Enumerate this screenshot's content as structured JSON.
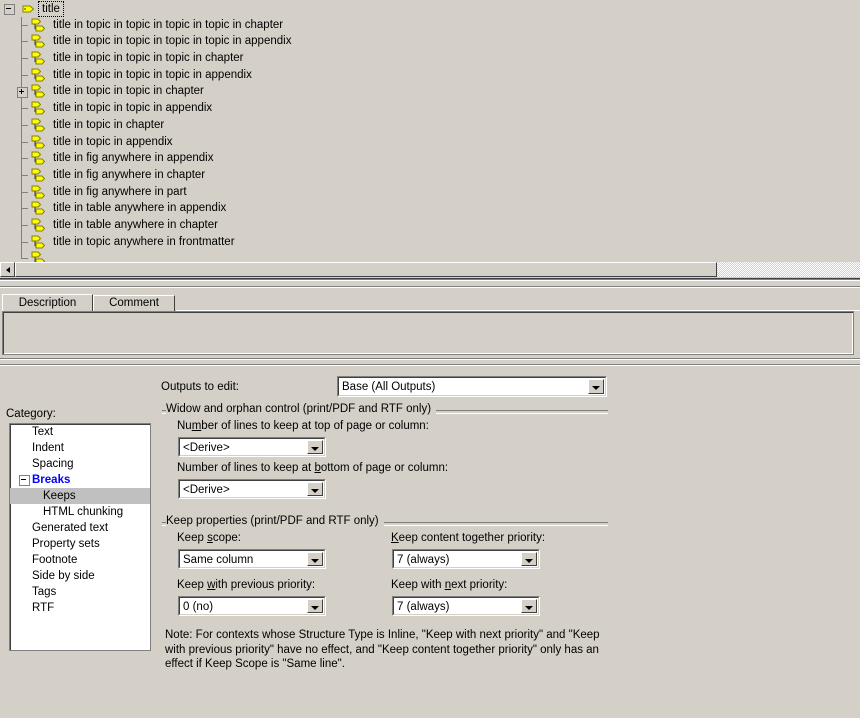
{
  "tree": {
    "root": {
      "label": "title",
      "icon": "tag-icon",
      "expander": "minus"
    },
    "items": [
      {
        "label": "title in topic in topic in topic in topic in chapter",
        "icon": "context-tag-icon",
        "expander": null
      },
      {
        "label": "title in topic in topic in topic in topic in appendix",
        "icon": "context-tag-icon",
        "expander": null
      },
      {
        "label": "title in topic in topic in topic in chapter",
        "icon": "context-tag-icon",
        "expander": null
      },
      {
        "label": "title in topic in topic in topic in appendix",
        "icon": "context-tag-icon",
        "expander": null
      },
      {
        "label": "title in topic in topic in chapter",
        "icon": "context-tag-icon",
        "expander": "plus"
      },
      {
        "label": "title in topic in topic in appendix",
        "icon": "context-tag-icon",
        "expander": null
      },
      {
        "label": "title in topic in chapter",
        "icon": "context-tag-icon",
        "expander": null
      },
      {
        "label": "title in topic in appendix",
        "icon": "context-tag-icon",
        "expander": null
      },
      {
        "label": "title in fig anywhere in appendix",
        "icon": "context-tag-icon",
        "expander": null
      },
      {
        "label": "title in fig anywhere in chapter",
        "icon": "context-tag-icon",
        "expander": null
      },
      {
        "label": "title in fig anywhere in part",
        "icon": "context-tag-icon",
        "expander": null
      },
      {
        "label": "title in table anywhere in appendix",
        "icon": "context-tag-icon",
        "expander": null
      },
      {
        "label": "title in table anywhere in chapter",
        "icon": "context-tag-icon",
        "expander": null
      },
      {
        "label": "title in topic anywhere in frontmatter",
        "icon": "context-tag-icon",
        "expander": null
      }
    ]
  },
  "scrollbar": {
    "left_arrow_icon": "triangle-left-icon"
  },
  "tabs": {
    "items": [
      {
        "label": "Description",
        "selected": true
      },
      {
        "label": "Comment",
        "selected": false
      }
    ]
  },
  "description": {
    "value": ""
  },
  "outputs": {
    "label": "Outputs to edit:",
    "value": "Base (All Outputs)",
    "dropdown_icon": "chevron-down-icon"
  },
  "category": {
    "label": "Category:",
    "items": [
      {
        "label": "Text",
        "type": "item",
        "selected": false
      },
      {
        "label": "Indent",
        "type": "item",
        "selected": false
      },
      {
        "label": "Spacing",
        "type": "item",
        "selected": false
      },
      {
        "label": "Breaks",
        "type": "group",
        "selected": false
      },
      {
        "label": "Keeps",
        "type": "child",
        "selected": true
      },
      {
        "label": "HTML chunking",
        "type": "child",
        "selected": false
      },
      {
        "label": "Generated text",
        "type": "item",
        "selected": false
      },
      {
        "label": "Property sets",
        "type": "item",
        "selected": false
      },
      {
        "label": "Footnote",
        "type": "item",
        "selected": false
      },
      {
        "label": "Side by side",
        "type": "item",
        "selected": false
      },
      {
        "label": "Tags",
        "type": "item",
        "selected": false
      },
      {
        "label": "RTF",
        "type": "item",
        "selected": false
      }
    ]
  },
  "widow_group": {
    "title": "Widow and orphan control (print/PDF and RTF only)",
    "top_label_pre": "Nu",
    "top_label_accel": "m",
    "top_label_post": "ber of lines to keep at top of page or column:",
    "top_value": "<Derive>",
    "bottom_label_pre": "Number of lines to keep at ",
    "bottom_label_accel": "b",
    "bottom_label_post": "ottom of page or column:",
    "bottom_value": "<Derive>"
  },
  "keep_group": {
    "title": "Keep properties (print/PDF and RTF only)",
    "scope_label_pre": "Keep ",
    "scope_label_accel": "s",
    "scope_label_post": "cope:",
    "scope_value": "Same column",
    "together_label_pre": "",
    "together_label_accel": "K",
    "together_label_post": "eep content together priority:",
    "together_value": "7 (always)",
    "previous_label_pre": "Keep ",
    "previous_label_accel": "w",
    "previous_label_post": "ith previous priority:",
    "previous_value": "0 (no)",
    "next_label_pre": "Keep with ",
    "next_label_accel": "n",
    "next_label_post": "ext priority:",
    "next_value": "7 (always)"
  },
  "note": {
    "text": "Note: For contexts whose Structure Type is Inline, \"Keep with next priority\" and \"Keep with previous priority\" have no effect, and \"Keep content together priority\" only has an effect if Keep Scope is \"Same line\"."
  },
  "colors": {
    "face": "#d4d0c8",
    "tree_bg": "#d4d0c8",
    "accent_blue": "#0000ff",
    "selection": "#c0c0c0",
    "icon_yellow": "#ffff00"
  }
}
